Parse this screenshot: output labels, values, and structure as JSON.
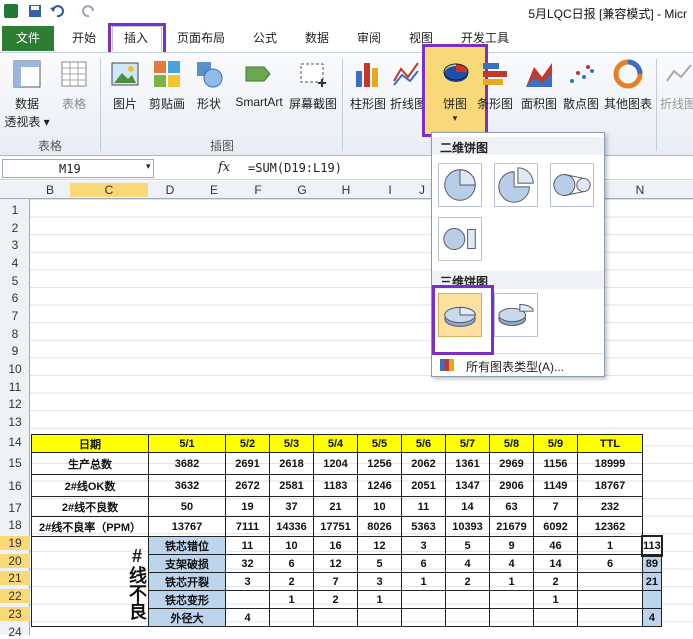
{
  "window": {
    "title": "5月LQC日报  [兼容模式] - Micr"
  },
  "tabs": [
    "文件",
    "开始",
    "插入",
    "页面布局",
    "公式",
    "数据",
    "审阅",
    "视图",
    "开发工具"
  ],
  "ribbon": {
    "buttons": {
      "pivot": [
        "数据",
        "透视表 ▾"
      ],
      "table": "表格",
      "picture": "图片",
      "clipart": "剪贴画",
      "shapes": "形状",
      "smartart": "SmartArt",
      "screenshot": "屏幕截图",
      "column": "柱形图",
      "line": "折线图",
      "pie": "饼图",
      "bar": "条形图",
      "area": "面积图",
      "scatter": "散点图",
      "other": "其他图表",
      "sparkline": "折线图"
    },
    "groups": {
      "tables": "表格",
      "illustrations": "插图"
    }
  },
  "formula_bar": {
    "name_box": "M19",
    "fx": "fx",
    "formula": "=SUM(D19:L19)"
  },
  "columns": [
    "B",
    "C",
    "D",
    "E",
    "F",
    "G",
    "H",
    "I",
    "J",
    "N"
  ],
  "rows": [
    "1",
    "2",
    "3",
    "4",
    "5",
    "6",
    "7",
    "8",
    "9",
    "10",
    "11",
    "12",
    "13",
    "14",
    "15",
    "16",
    "17",
    "18",
    "19",
    "20",
    "21",
    "22",
    "23",
    "24"
  ],
  "dropdown": {
    "section_2d": "二维饼图",
    "section_3d": "三维饼图",
    "all_chart_types": "所有图表类型(A)..."
  },
  "sheet": {
    "header": [
      "日期",
      "5/1",
      "5/2",
      "5/3",
      "5/4",
      "5/5",
      "5/6",
      "5/7",
      "5/8",
      "5/9",
      "TTL"
    ],
    "summary_rows": [
      {
        "label": "生产总数",
        "values": [
          "3682",
          "2691",
          "2618",
          "1204",
          "1256",
          "2062",
          "1361",
          "2969",
          "1156",
          "18999"
        ]
      },
      {
        "label": "2#线OK数",
        "values": [
          "3632",
          "2672",
          "2581",
          "1183",
          "1246",
          "2051",
          "1347",
          "2906",
          "1149",
          "18767"
        ]
      },
      {
        "label": "2#线不良数",
        "values": [
          "50",
          "19",
          "37",
          "21",
          "10",
          "11",
          "14",
          "63",
          "7",
          "232"
        ]
      },
      {
        "label": "2#线不良率（PPM）",
        "values": [
          "13767",
          "7111",
          "14336",
          "17751",
          "8026",
          "5363",
          "10393",
          "21679",
          "6092",
          "12362"
        ]
      }
    ],
    "defect_group_label": "#线不良",
    "defect_rows": [
      {
        "label": "铁芯错位",
        "values": [
          "11",
          "10",
          "16",
          "12",
          "3",
          "5",
          "9",
          "46",
          "1",
          "113"
        ]
      },
      {
        "label": "支架破损",
        "values": [
          "32",
          "6",
          "12",
          "5",
          "6",
          "4",
          "4",
          "14",
          "6",
          "89"
        ]
      },
      {
        "label": "铁芯开裂",
        "values": [
          "3",
          "2",
          "7",
          "3",
          "1",
          "2",
          "1",
          "2",
          "",
          "21"
        ]
      },
      {
        "label": "铁芯变形",
        "values": [
          "",
          "1",
          "2",
          "1",
          "",
          "",
          "",
          "1",
          "",
          ""
        ]
      },
      {
        "label": "外径大",
        "values": [
          "4",
          "",
          "",
          "",
          "",
          "",
          "",
          "",
          "",
          "4"
        ]
      }
    ]
  }
}
